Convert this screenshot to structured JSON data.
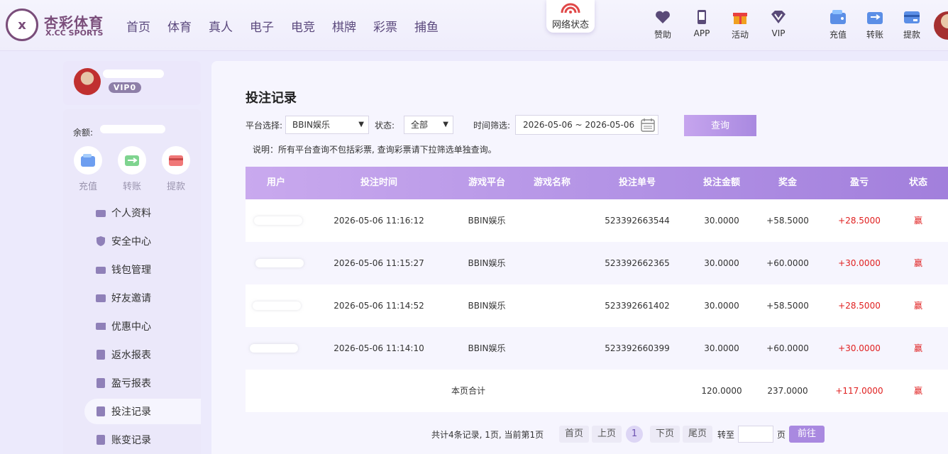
{
  "header": {
    "logo_cn": "杏彩体育",
    "logo_en": "X.CC SPORTS",
    "logo_mark": "x",
    "nav": [
      "首页",
      "体育",
      "真人",
      "电子",
      "电竞",
      "棋牌",
      "彩票",
      "捕鱼"
    ],
    "network_status": "网络状态",
    "icons": [
      {
        "label": "赞助",
        "icon": "heart-icon"
      },
      {
        "label": "APP",
        "icon": "phone-icon"
      },
      {
        "label": "活动",
        "icon": "gift-icon"
      },
      {
        "label": "VIP",
        "icon": "diamond-icon"
      },
      {
        "label": "充值",
        "icon": "wallet-icon"
      },
      {
        "label": "转账",
        "icon": "transfer-icon"
      },
      {
        "label": "提款",
        "icon": "withdraw-icon"
      }
    ]
  },
  "sidebar": {
    "vip": "VIP0",
    "balance_label": "余额:",
    "quick": [
      "充值",
      "转账",
      "提款"
    ],
    "menu": [
      "个人资料",
      "安全中心",
      "钱包管理",
      "好友邀请",
      "优惠中心",
      "返水报表",
      "盈亏报表",
      "投注记录",
      "账变记录"
    ],
    "active": "投注记录"
  },
  "main": {
    "title": "投注记录",
    "filters": {
      "platform_label": "平台选择:",
      "platform_value": "BBIN娱乐",
      "status_label": "状态:",
      "status_value": "全部",
      "time_label": "时间筛选:",
      "date_range": "2026-05-06 ~ 2026-05-06",
      "query_button": "查询"
    },
    "note": "说明：所有平台查询不包括彩票, 查询彩票请下拉筛选单独查询。",
    "columns": [
      "用户",
      "投注时间",
      "游戏平台",
      "游戏名称",
      "投注单号",
      "投注金额",
      "奖金",
      "盈亏",
      "状态"
    ],
    "rows": [
      {
        "time": "2026-05-06 11:16:12",
        "platform": "BBIN娱乐",
        "game": "",
        "order": "523392663544",
        "amount": "30.0000",
        "bonus": "+58.5000",
        "profit": "+28.5000",
        "status": "赢"
      },
      {
        "time": "2026-05-06 11:15:27",
        "platform": "BBIN娱乐",
        "game": "",
        "order": "523392662365",
        "amount": "30.0000",
        "bonus": "+60.0000",
        "profit": "+30.0000",
        "status": "赢"
      },
      {
        "time": "2026-05-06 11:14:52",
        "platform": "BBIN娱乐",
        "game": "",
        "order": "523392661402",
        "amount": "30.0000",
        "bonus": "+58.5000",
        "profit": "+28.5000",
        "status": "赢"
      },
      {
        "time": "2026-05-06 11:14:10",
        "platform": "BBIN娱乐",
        "game": "",
        "order": "523392660399",
        "amount": "30.0000",
        "bonus": "+60.0000",
        "profit": "+30.0000",
        "status": "赢"
      }
    ],
    "summary": {
      "label": "本页合计",
      "amount": "120.0000",
      "bonus": "237.0000",
      "profit": "+117.0000",
      "status": "赢"
    },
    "pager": {
      "info": "共计4条记录,  1页, 当前第1页",
      "first": "首页",
      "prev": "上页",
      "current": "1",
      "next": "下页",
      "last": "尾页",
      "goto_label": "转至",
      "page_unit": "页",
      "goto_button": "前往"
    }
  },
  "colors": {
    "accent": "#a989e0",
    "profit": "#e02020",
    "brand": "#7a4d7a"
  }
}
